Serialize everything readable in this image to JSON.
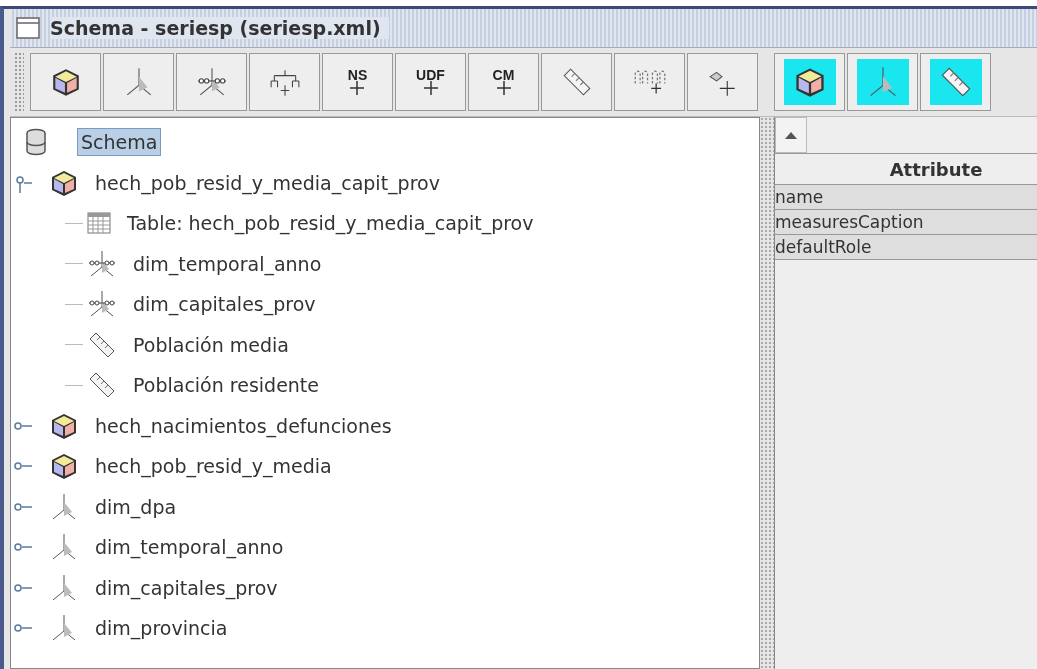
{
  "window": {
    "title": "Schema - seriesp (seriesp.xml)"
  },
  "toolbar": [
    {
      "kind": "cube"
    },
    {
      "kind": "dimension"
    },
    {
      "kind": "dimension-usage"
    },
    {
      "kind": "hierarchy"
    },
    {
      "kind": "text",
      "label": "NS"
    },
    {
      "kind": "text",
      "label": "UDF"
    },
    {
      "kind": "text",
      "label": "CM"
    },
    {
      "kind": "measure"
    },
    {
      "kind": "level"
    },
    {
      "kind": "property"
    }
  ],
  "toolbar_highlighted": [
    {
      "kind": "cube"
    },
    {
      "kind": "dimension"
    },
    {
      "kind": "measure"
    }
  ],
  "tree": {
    "label": "Schema",
    "kind": "schema",
    "selected": true,
    "children": [
      {
        "label": "hech_pob_resid_y_media_capit_prov",
        "kind": "cube",
        "selected": false,
        "expanded": true,
        "children": [
          {
            "label": "Table: hech_pob_resid_y_media_capit_prov",
            "kind": "table",
            "selected": false
          },
          {
            "label": "dim_temporal_anno",
            "kind": "dimension-usage",
            "selected": false
          },
          {
            "label": "dim_capitales_prov",
            "kind": "dimension-usage",
            "selected": false
          },
          {
            "label": "Población media",
            "kind": "measure",
            "selected": false
          },
          {
            "label": "Población residente",
            "kind": "measure",
            "selected": false
          }
        ]
      },
      {
        "label": "hech_nacimientos_defunciones",
        "kind": "cube",
        "selected": false,
        "expanded": false
      },
      {
        "label": "hech_pob_resid_y_media",
        "kind": "cube",
        "selected": false,
        "expanded": false
      },
      {
        "label": "dim_dpa",
        "kind": "dimension",
        "selected": false,
        "expanded": false
      },
      {
        "label": "dim_temporal_anno",
        "kind": "dimension",
        "selected": false,
        "expanded": false
      },
      {
        "label": "dim_capitales_prov",
        "kind": "dimension",
        "selected": false,
        "expanded": false
      },
      {
        "label": "dim_provincia",
        "kind": "dimension",
        "selected": false,
        "expanded": false
      }
    ]
  },
  "attributes": {
    "header": "Attribute",
    "rows": [
      "name",
      "measuresCaption",
      "defaultRole"
    ]
  }
}
